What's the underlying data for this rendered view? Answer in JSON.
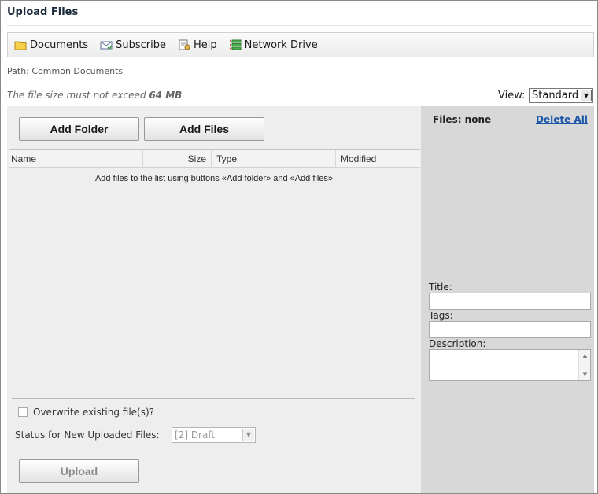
{
  "window": {
    "title": "Upload Files"
  },
  "toolbar": {
    "documents": "Documents",
    "subscribe": "Subscribe",
    "help": "Help",
    "network_drive": "Network Drive"
  },
  "path": "Path: Common Documents",
  "limit": {
    "prefix": "The file size must not exceed ",
    "value": "64 MB",
    "suffix": "."
  },
  "view": {
    "label": "View:",
    "selected": "Standard"
  },
  "buttons": {
    "add_folder": "Add Folder",
    "add_files": "Add Files",
    "upload": "Upload"
  },
  "table": {
    "columns": [
      "Name",
      "Size",
      "Type",
      "Modified"
    ],
    "empty_message": "Add files to the list using buttons «Add folder» and «Add files»"
  },
  "options": {
    "overwrite": "Overwrite existing file(s)?",
    "status_label": "Status for New Uploaded Files:",
    "status_selected": "[2] Draft"
  },
  "side": {
    "files_count": "Files: none",
    "delete_all": "Delete All",
    "title_label": "Title:",
    "tags_label": "Tags:",
    "description_label": "Description:"
  },
  "colors": {
    "left_pane": "#eeeeee",
    "right_pane": "#d8d8d8",
    "link": "#1a55a8"
  }
}
